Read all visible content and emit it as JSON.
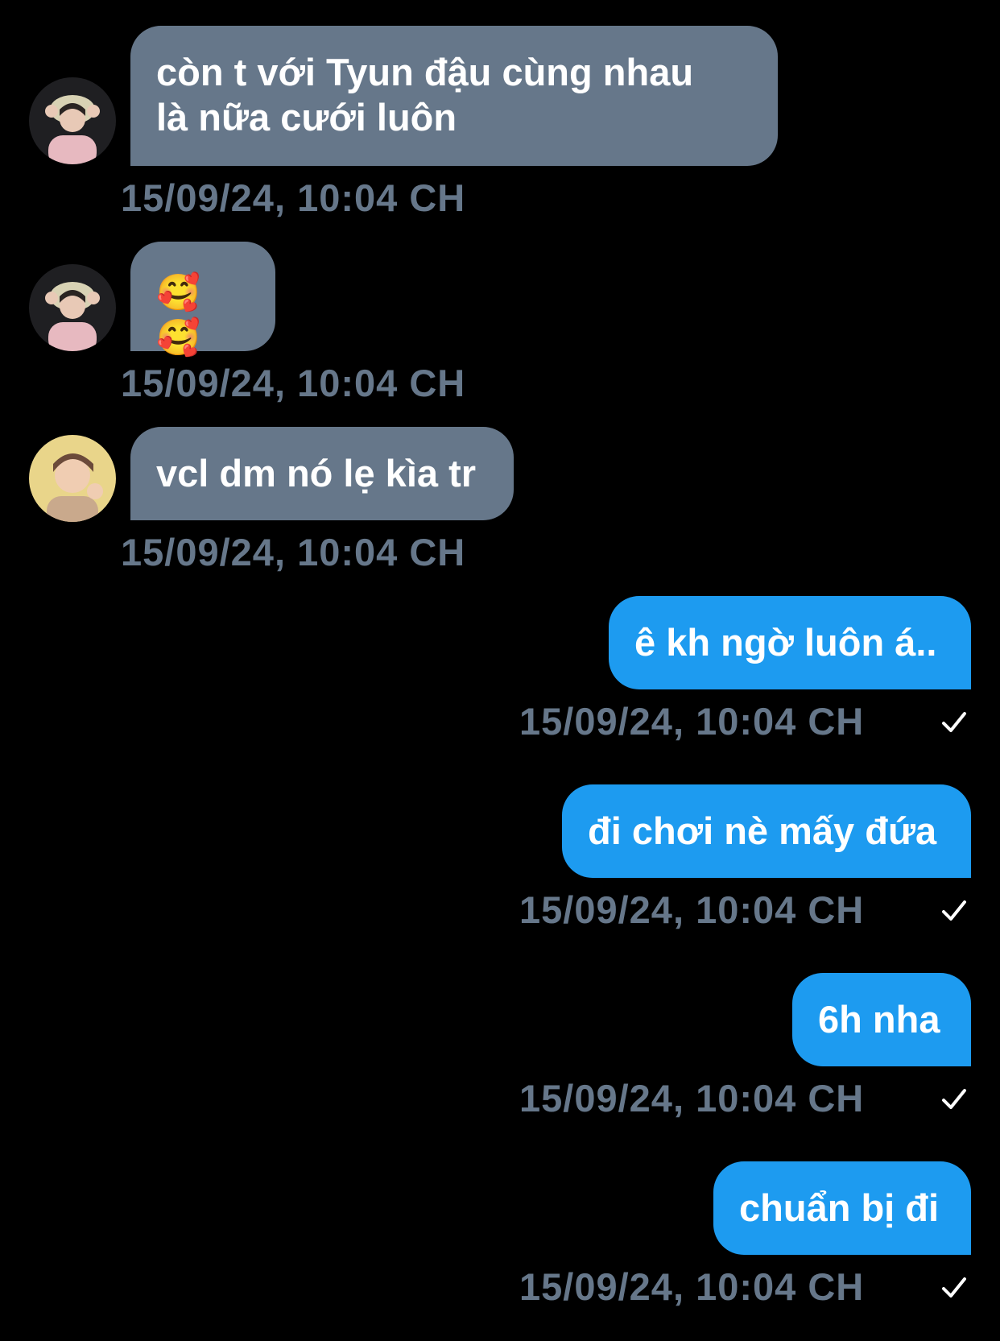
{
  "messages": [
    {
      "dir": "in",
      "avatar": "avatar-a",
      "lines": [
        "còn t với Tyun đậu cùng nhau",
        "là nữa cưới luôn"
      ],
      "time": "15/09/24, 10:04 CH"
    },
    {
      "dir": "in",
      "avatar": "avatar-a",
      "lines": [
        "🥰 🥰"
      ],
      "time": "15/09/24, 10:04 CH"
    },
    {
      "dir": "in",
      "avatar": "avatar-b",
      "lines": [
        "vcl dm nó lẹ kìa tr"
      ],
      "time": "15/09/24, 10:04 CH"
    },
    {
      "dir": "out",
      "lines": [
        "ê kh ngờ luôn á.."
      ],
      "time": "15/09/24, 10:04 CH",
      "status": "sent-check"
    },
    {
      "dir": "out",
      "lines": [
        "đi chơi nè mấy đứa"
      ],
      "time": "15/09/24, 10:04 CH",
      "status": "sent-check"
    },
    {
      "dir": "out",
      "lines": [
        "6h nha"
      ],
      "time": "15/09/24, 10:04 CH",
      "status": "sent-check"
    },
    {
      "dir": "out",
      "lines": [
        "chuẩn bị đi"
      ],
      "time": "15/09/24, 10:04 CH",
      "status": "sent-check"
    }
  ],
  "colors": {
    "background": "#000000",
    "incoming_bubble": "#66778a",
    "outgoing_bubble": "#1d9bf0",
    "timestamp": "#66778a",
    "text": "#ffffff"
  }
}
